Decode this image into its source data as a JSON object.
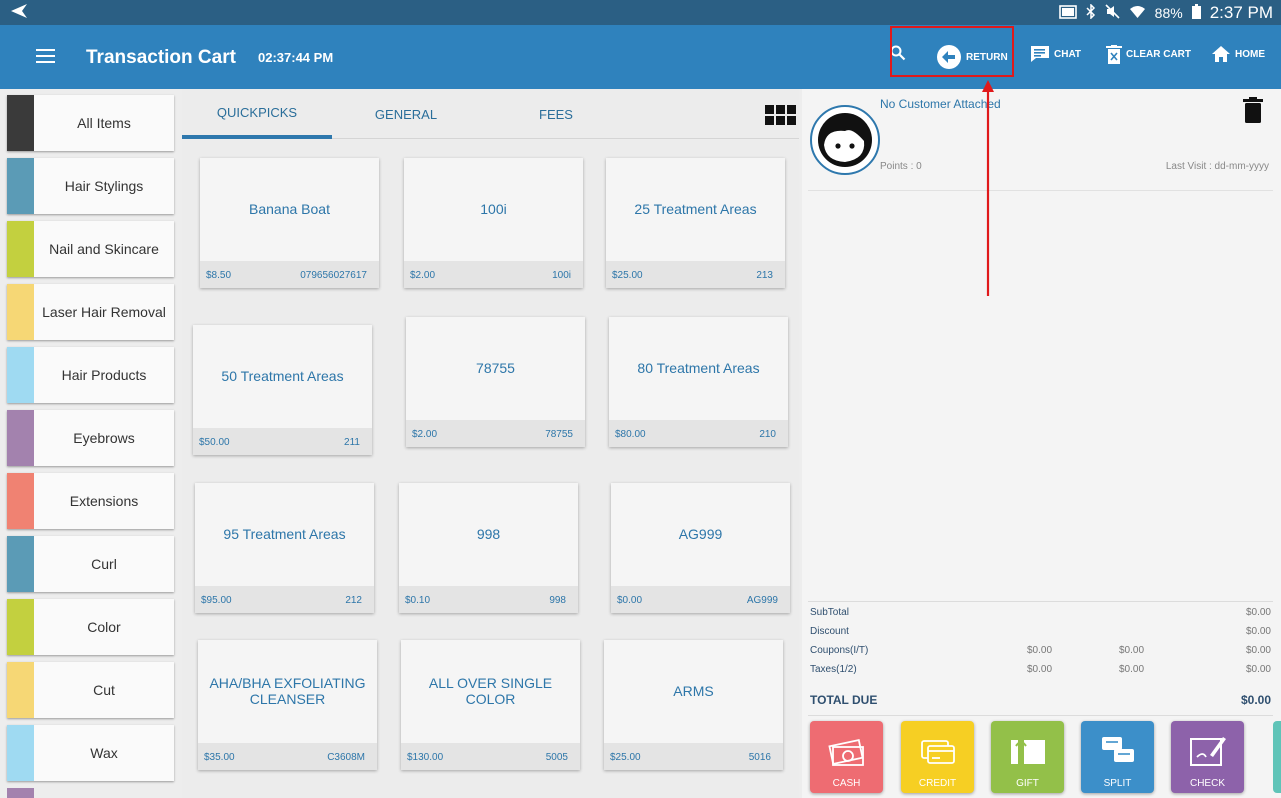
{
  "status_bar": {
    "back_icon": "back-arrow-icon",
    "battery": "88%",
    "time": "2:37 PM"
  },
  "app_bar": {
    "title": "Transaction Cart",
    "clock": "02:37:44 PM",
    "actions": {
      "return": "RETURN",
      "chat": "CHAT",
      "clear_cart": "CLEAR CART",
      "home": "HOME"
    },
    "highlight_color": "#e0191b"
  },
  "categories": [
    {
      "label": "All Items",
      "color": "#3a3a3a"
    },
    {
      "label": "Hair Stylings",
      "color": "#5b9bb6"
    },
    {
      "label": "Nail and Skincare",
      "color": "#c3d03f"
    },
    {
      "label": "Laser Hair Removal",
      "color": "#f6d775"
    },
    {
      "label": "Hair Products",
      "color": "#9fdaf2"
    },
    {
      "label": "Eyebrows",
      "color": "#a382ae"
    },
    {
      "label": "Extensions",
      "color": "#f08272"
    },
    {
      "label": "Curl",
      "color": "#5b9bb6"
    },
    {
      "label": "Color",
      "color": "#c3d03f"
    },
    {
      "label": "Cut",
      "color": "#f6d775"
    },
    {
      "label": "Wax",
      "color": "#9fdaf2"
    }
  ],
  "tabs": [
    {
      "label": "QUICKPICKS",
      "active": true
    },
    {
      "label": "GENERAL",
      "active": false
    },
    {
      "label": "FEES",
      "active": false
    }
  ],
  "products": [
    {
      "name": "Banana Boat",
      "price": "$8.50",
      "sku": "079656027617"
    },
    {
      "name": "100i",
      "price": "$2.00",
      "sku": "100i"
    },
    {
      "name": "25 Treatment Areas",
      "price": "$25.00",
      "sku": "213"
    },
    {
      "name": "50 Treatment Areas",
      "price": "$50.00",
      "sku": "211"
    },
    {
      "name": "78755",
      "price": "$2.00",
      "sku": "78755"
    },
    {
      "name": "80 Treatment Areas",
      "price": "$80.00",
      "sku": "210"
    },
    {
      "name": "95 Treatment Areas",
      "price": "$95.00",
      "sku": "212"
    },
    {
      "name": "998",
      "price": "$0.10",
      "sku": "998"
    },
    {
      "name": "AG999",
      "price": "$0.00",
      "sku": "AG999"
    },
    {
      "name": "AHA/BHA EXFOLIATING CLEANSER",
      "price": "$35.00",
      "sku": "C3608M"
    },
    {
      "name": "ALL OVER SINGLE COLOR",
      "price": "$130.00",
      "sku": "5005"
    },
    {
      "name": "ARMS",
      "price": "$25.00",
      "sku": "5016"
    }
  ],
  "customer": {
    "name": "No Customer Attached",
    "points": "Points : 0",
    "last_visit": "Last Visit : dd-mm-yyyy"
  },
  "totals": {
    "subtotal": {
      "label": "SubTotal",
      "value": "$0.00"
    },
    "discount": {
      "label": "Discount",
      "value": "$0.00"
    },
    "coupons": {
      "label": "Coupons(I/T)",
      "c1": "$0.00",
      "c2": "$0.00",
      "value": "$0.00"
    },
    "taxes": {
      "label": "Taxes(1/2)",
      "c1": "$0.00",
      "c2": "$0.00",
      "value": "$0.00"
    },
    "total_due": {
      "label": "TOTAL DUE",
      "value": "$0.00"
    }
  },
  "payments": [
    {
      "label": "CASH",
      "color": "#ee6c72",
      "icon": "cash-icon"
    },
    {
      "label": "CREDIT",
      "color": "#f6cf23",
      "icon": "credit-card-icon"
    },
    {
      "label": "GIFT",
      "color": "#93c049",
      "icon": "gift-card-icon"
    },
    {
      "label": "SPLIT",
      "color": "#3c8fc9",
      "icon": "split-icon"
    },
    {
      "label": "CHECK",
      "color": "#8d62aa",
      "icon": "check-icon"
    }
  ]
}
